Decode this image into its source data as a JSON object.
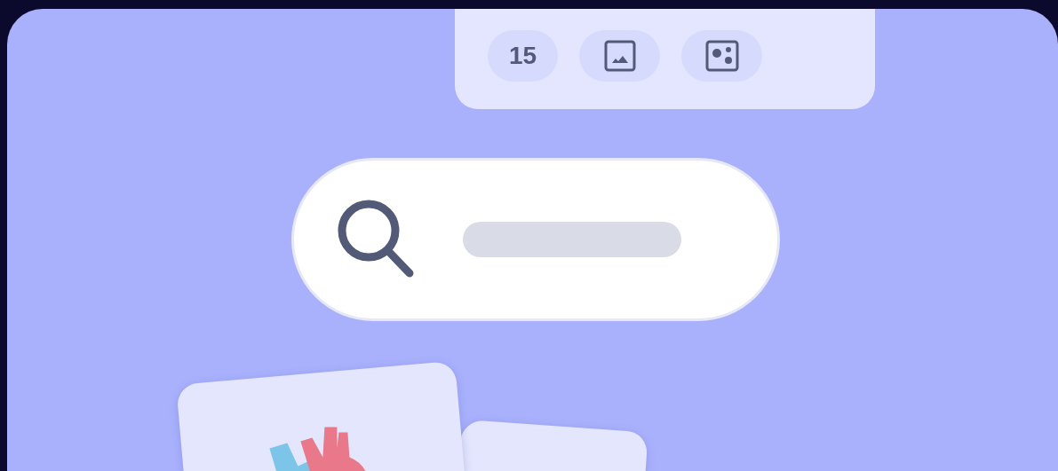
{
  "toolbar": {
    "chips": [
      {
        "kind": "count",
        "label": "15"
      },
      {
        "kind": "image"
      },
      {
        "kind": "media"
      }
    ]
  }
}
